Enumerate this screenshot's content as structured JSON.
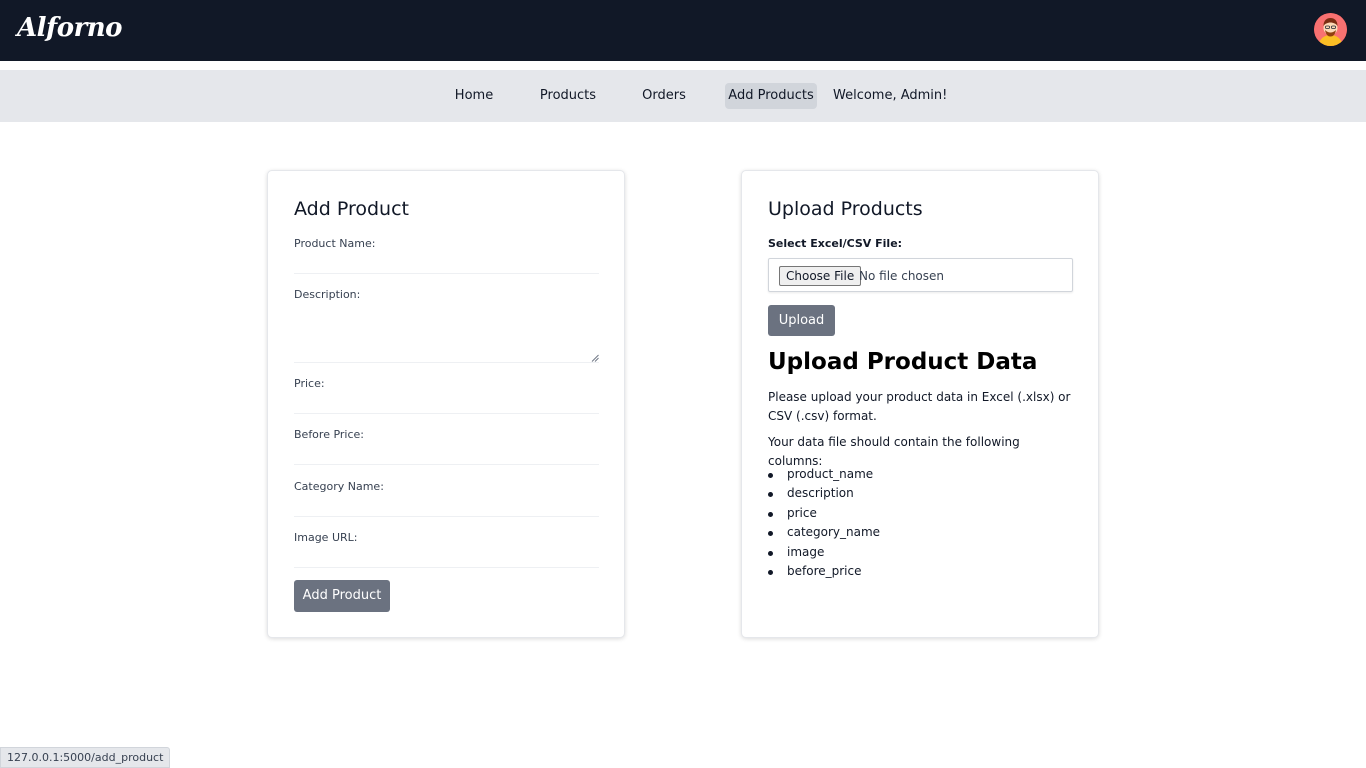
{
  "header": {
    "logo_text": "Alforno",
    "avatar_icon": "user-avatar"
  },
  "nav": {
    "items": [
      {
        "label": "Home",
        "active": false
      },
      {
        "label": "Products",
        "active": false
      },
      {
        "label": "Orders",
        "active": false
      },
      {
        "label": "Add Products",
        "active": true
      }
    ],
    "welcome": "Welcome, Admin!"
  },
  "add_product": {
    "title": "Add Product",
    "fields": {
      "product_name": {
        "label": "Product Name:",
        "value": ""
      },
      "description": {
        "label": "Description:",
        "value": ""
      },
      "price": {
        "label": "Price:",
        "value": ""
      },
      "before_price": {
        "label": "Before Price:",
        "value": ""
      },
      "category_name": {
        "label": "Category Name:",
        "value": ""
      },
      "image_url": {
        "label": "Image URL:",
        "value": ""
      }
    },
    "submit_label": "Add Product"
  },
  "upload": {
    "title": "Upload Products",
    "file_label": "Select Excel/CSV File:",
    "choose_label": "Choose File",
    "no_file_text": "No file chosen",
    "upload_label": "Upload",
    "heading": "Upload Product Data",
    "instructions": "Please upload your product data in Excel (.xlsx) or CSV (.csv) format.",
    "columns_intro": "Your data file should contain the following columns:",
    "columns": [
      "product_name",
      "description",
      "price",
      "category_name",
      "image",
      "before_price"
    ]
  },
  "status_bar": {
    "url": "127.0.0.1:5000/add_product"
  },
  "colors": {
    "header_bg": "#111827",
    "nav_bg": "#e5e7eb",
    "nav_active_bg": "#d1d5db",
    "button_bg": "#6b7280",
    "avatar_bg": "#ef4444"
  }
}
